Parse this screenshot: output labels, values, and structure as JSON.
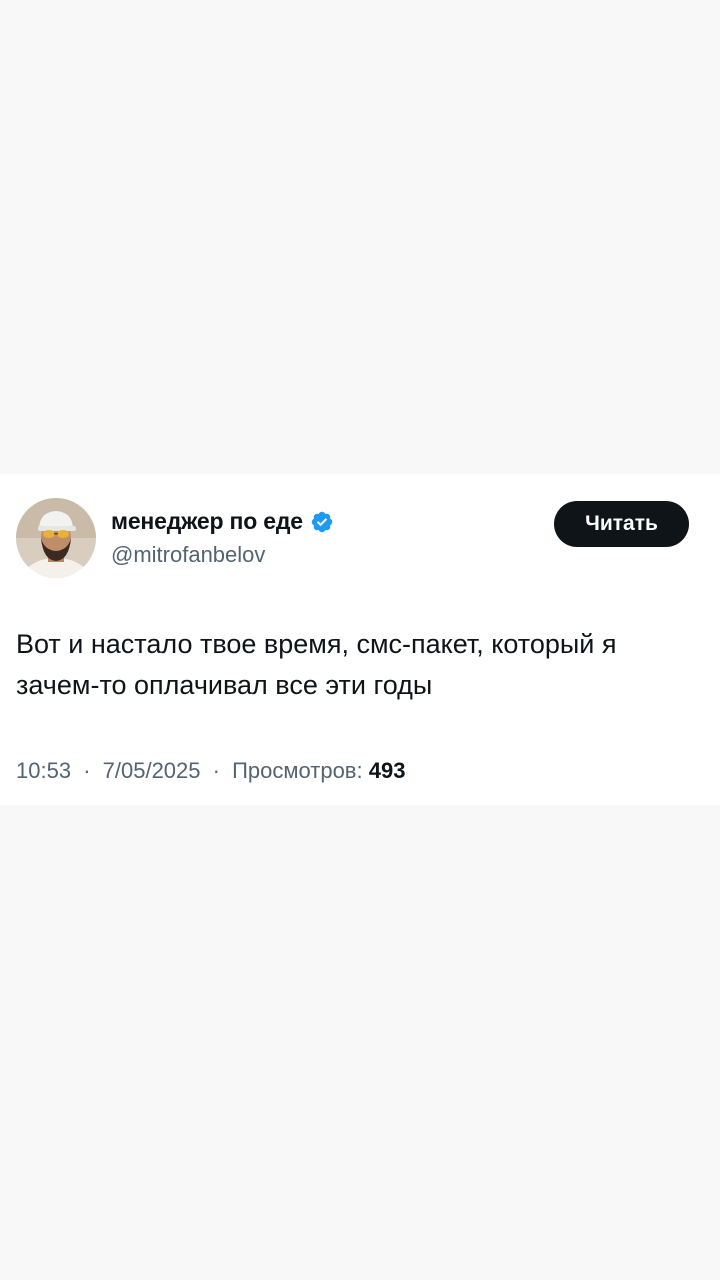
{
  "tweet": {
    "author": {
      "display_name": "менеджер по еде",
      "handle": "@mitrofanbelov",
      "verified": true,
      "verified_color": "#1d9bf0",
      "avatar_icon": "profile-photo"
    },
    "follow_button_label": "Читать",
    "text": "Вот и настало твое время, смс-пакет, который я зачем-то оплачивал все эти годы",
    "meta": {
      "time": "10:53",
      "separator": "·",
      "date": "7/05/2025",
      "views_label": "Просмотров:",
      "views_count": "493"
    }
  }
}
